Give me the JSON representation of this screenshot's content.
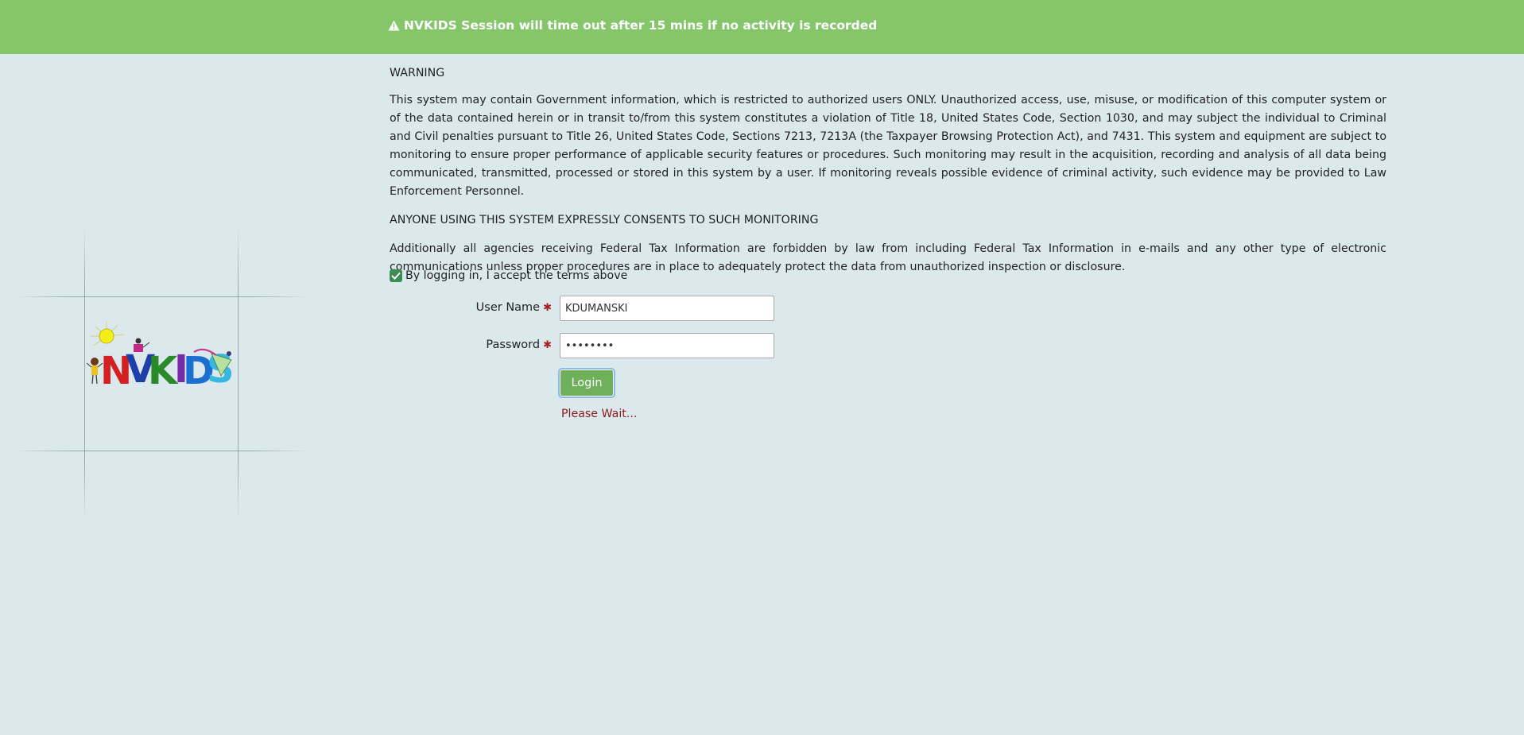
{
  "banner": {
    "icon": "warning-icon",
    "message": "NVKIDS Session will time out after 15 mins if no activity is recorded",
    "background": "#86c66b"
  },
  "logo": {
    "name": "NVKIDS logo",
    "letters": [
      "N",
      "V",
      "K",
      "I",
      "D",
      "S"
    ]
  },
  "notice": {
    "heading": "WARNING",
    "body": "This system may contain Government information, which is restricted to authorized users ONLY. Unauthorized access, use, misuse, or modification of this computer system or of the data contained herein or in transit to/from this system constitutes a violation of Title 18, United States Code, Section 1030, and may subject the individual to Criminal and Civil penalties pursuant to Title 26, United States Code, Sections 7213, 7213A (the Taxpayer Browsing Protection Act), and 7431. This system and equipment are subject to monitoring to ensure proper performance of applicable security features or procedures. Such monitoring may result in the acquisition, recording and analysis of all data being communicated, transmitted, processed or stored in this system by a user. If monitoring reveals possible evidence of criminal activity, such evidence may be provided to Law Enforcement Personnel.",
    "consent": "ANYONE USING THIS SYSTEM EXPRESSLY CONSENTS TO SUCH MONITORING",
    "additional": "Additionally all agencies receiving Federal Tax Information are forbidden by law from including Federal Tax Information in e-mails and any other type of electronic communications unless proper procedures are in place to adequately protect the data from unauthorized inspection or disclosure."
  },
  "form": {
    "accept_label": "By logging in, I accept the terms above",
    "accept_checked": true,
    "username_label": "User Name",
    "username_value": "KDUMANSKI",
    "password_label": "Password",
    "password_value": "••••••••",
    "required_mark": "✱",
    "login_label": "Login",
    "status_text": "Please Wait..."
  }
}
